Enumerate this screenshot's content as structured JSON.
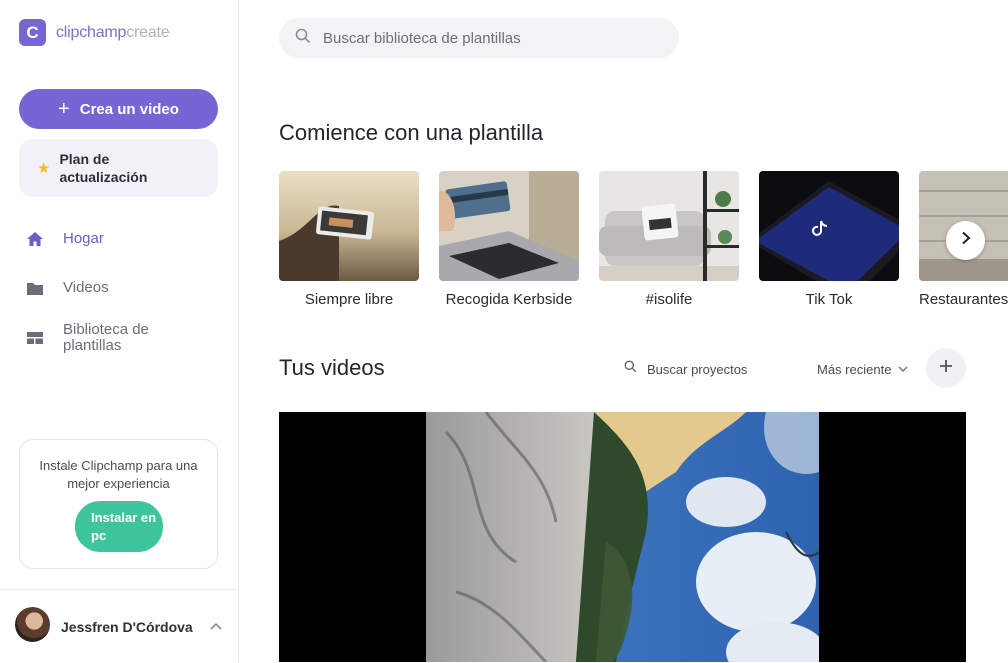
{
  "brand": {
    "logo_letter": "C",
    "name_bold": "clipchamp",
    "name_light": "create"
  },
  "sidebar": {
    "create_label": "Crea un video",
    "upgrade_label": "Plan de actualización",
    "nav": [
      {
        "label": "Hogar",
        "icon": "home-icon",
        "active": true
      },
      {
        "label": "Videos",
        "icon": "folder-icon",
        "active": false
      },
      {
        "label": "Biblioteca de plantillas",
        "icon": "template-icon",
        "active": false
      }
    ],
    "install": {
      "message": "Instale Clipchamp para una mejor experiencia",
      "button": "Instalar en pc"
    },
    "user": {
      "name": "Jessfren D'Córdova"
    }
  },
  "main": {
    "search": {
      "placeholder": "Buscar biblioteca de plantillas"
    },
    "templates_title": "Comience con una plantilla",
    "templates": [
      {
        "name": "Siempre libre"
      },
      {
        "name": "Recogida Kerbside"
      },
      {
        "name": "#isolife"
      },
      {
        "name": "Tik Tok"
      },
      {
        "name": "Restaurantes"
      }
    ],
    "videos_title": "Tus videos",
    "project_search": "Buscar proyectos",
    "sort": "Más reciente"
  },
  "colors": {
    "accent": "#7467d4",
    "install_green": "#3ec59d",
    "star": "#f7b928"
  }
}
